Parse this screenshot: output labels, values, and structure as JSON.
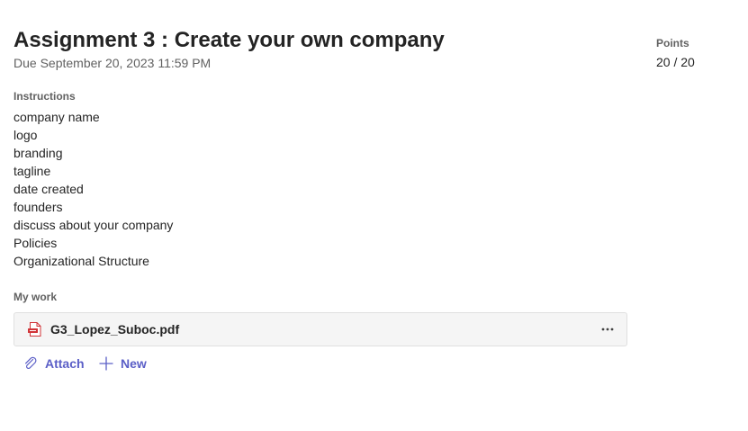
{
  "assignment": {
    "title": "Assignment 3 : Create your own company",
    "due": "Due September 20, 2023 11:59 PM"
  },
  "points": {
    "label": "Points",
    "value": "20 / 20"
  },
  "instructions": {
    "label": "Instructions",
    "items": [
      "company name",
      "logo",
      "branding",
      "tagline",
      "date created",
      "founders",
      "discuss about your company",
      "Policies",
      "Organizational Structure"
    ]
  },
  "my_work": {
    "label": "My work",
    "files": [
      {
        "name": "G3_Lopez_Suboc.pdf",
        "icon": "pdf-file-icon"
      }
    ],
    "actions": {
      "attach_label": "Attach",
      "attach_icon": "paperclip-icon",
      "new_label": "New",
      "new_icon": "plus-icon"
    }
  },
  "colors": {
    "accent": "#5b5fc7",
    "pdf_red": "#d13438"
  }
}
